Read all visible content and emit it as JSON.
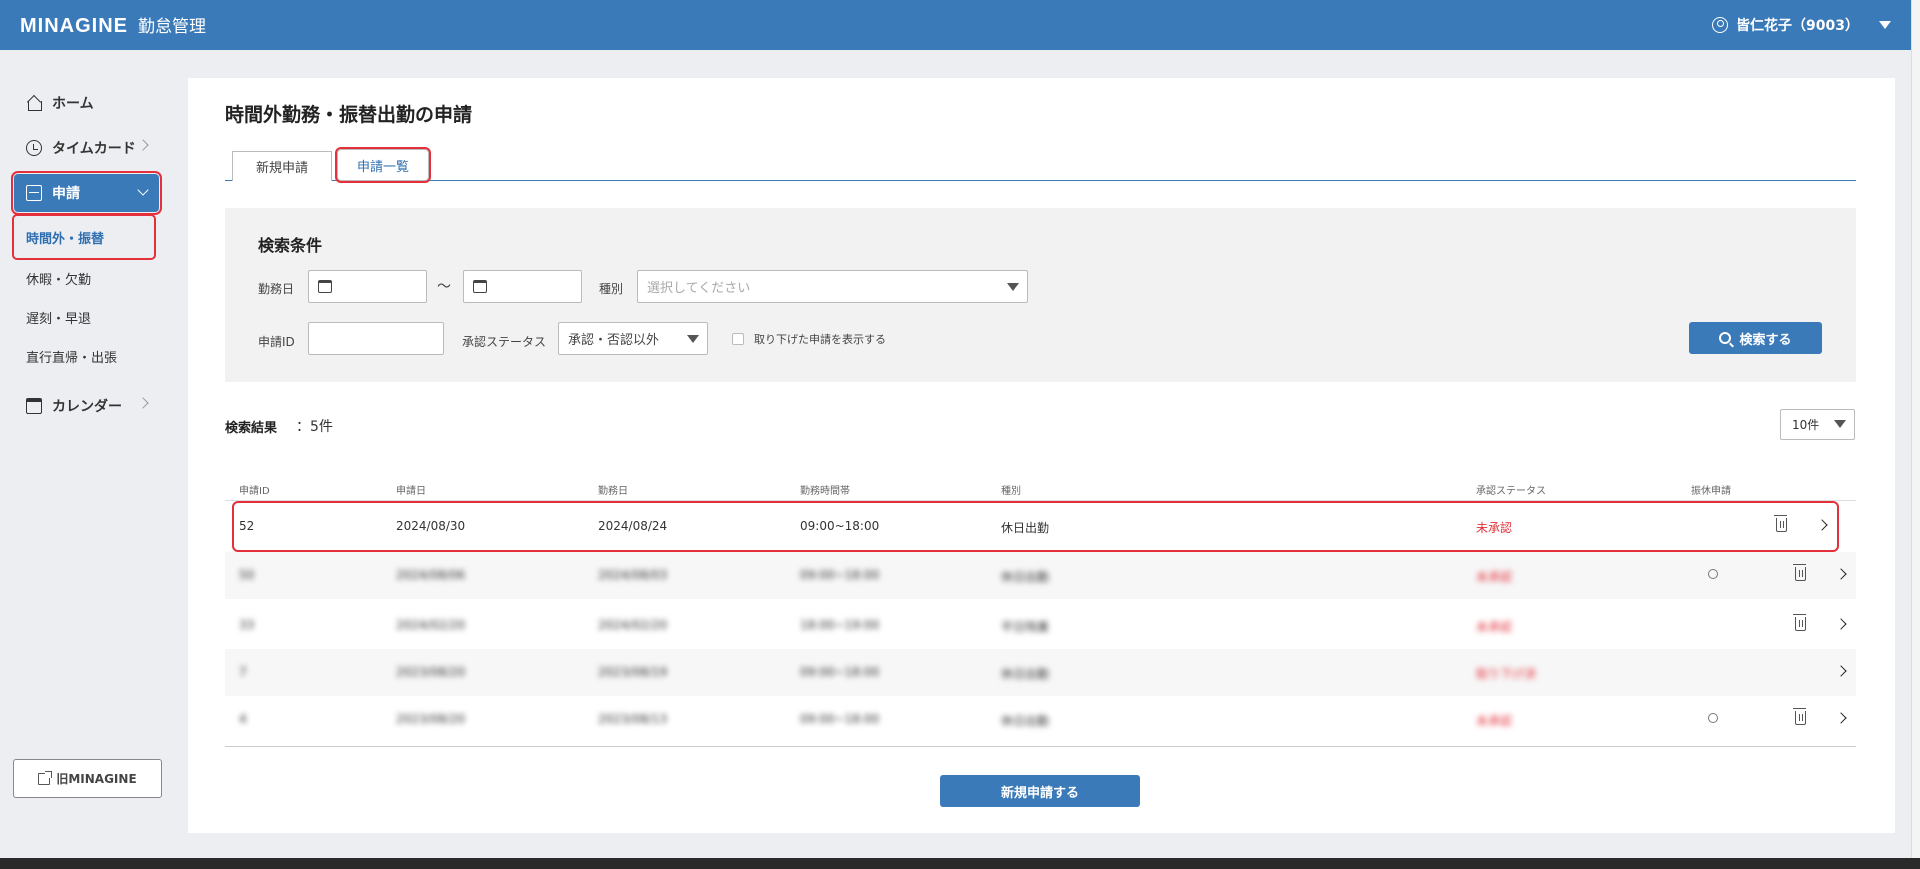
{
  "header": {
    "logo": "MINAGINE",
    "app_name": "勤怠管理",
    "user": "皆仁花子（9003）"
  },
  "sidebar": {
    "items": [
      {
        "label": "ホーム"
      },
      {
        "label": "タイムカード"
      },
      {
        "label": "申請"
      },
      {
        "label": "カレンダー"
      }
    ],
    "subitems": [
      {
        "label": "時間外・振替"
      },
      {
        "label": "休暇・欠勤"
      },
      {
        "label": "遅刻・早退"
      },
      {
        "label": "直行直帰・出張"
      }
    ],
    "old_link": "旧MINAGINE"
  },
  "page": {
    "title": "時間外勤務・振替出勤の申請",
    "tabs": [
      {
        "label": "新規申請"
      },
      {
        "label": "申請一覧"
      }
    ]
  },
  "search": {
    "title": "検索条件",
    "work_date_label": "勤務日",
    "range_sep": "～",
    "type_label": "種別",
    "type_placeholder": "選択してください",
    "id_label": "申請ID",
    "status_label": "承認ステータス",
    "status_value": "承認・否認以外",
    "withdrawn_label": "取り下げた申請を表示する",
    "search_button": "検索する"
  },
  "results": {
    "label": "検索結果",
    "count": "：5件",
    "per_page": "10件",
    "columns": [
      "申請ID",
      "申請日",
      "勤務日",
      "勤務時間帯",
      "種別",
      "承認ステータス",
      "振休申請"
    ],
    "rows": [
      {
        "id": "52",
        "applied": "2024/08/30",
        "work_date": "2024/08/24",
        "time": "09:00~18:00",
        "type": "休日出勤",
        "status": "未承認"
      },
      {
        "id": "50",
        "applied": "2024/08/06",
        "work_date": "2024/08/03",
        "time": "09:00~18:00",
        "type": "休日出勤",
        "status": "未承認"
      },
      {
        "id": "33",
        "applied": "2024/02/20",
        "work_date": "2024/02/20",
        "time": "18:00~19:00",
        "type": "平日残業",
        "status": "未承認"
      },
      {
        "id": "7",
        "applied": "2023/08/20",
        "work_date": "2023/08/19",
        "time": "09:00~18:00",
        "type": "休日出勤",
        "status": "取り下げ済"
      },
      {
        "id": "4",
        "applied": "2023/08/20",
        "work_date": "2023/08/13",
        "time": "09:00~18:00",
        "type": "休日出勤",
        "status": "未承認"
      }
    ]
  },
  "new_button": "新規申請する"
}
